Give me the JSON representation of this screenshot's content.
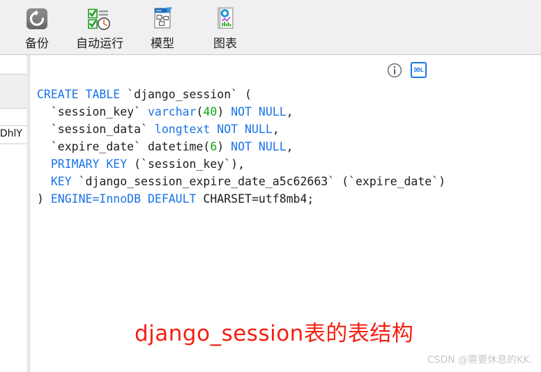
{
  "toolbar": {
    "buttons": [
      {
        "label": "备份",
        "icon": "backup-restore-icon"
      },
      {
        "label": "自动运行",
        "icon": "auto-run-schedule-icon"
      },
      {
        "label": "模型",
        "icon": "model-diagram-icon"
      },
      {
        "label": "图表",
        "icon": "chart-report-icon"
      }
    ]
  },
  "left_panel": {
    "rows": [
      {
        "text": ""
      },
      {
        "text": ""
      },
      {
        "text": "lDhlY"
      },
      {
        "text": ""
      }
    ]
  },
  "content": {
    "actions": [
      {
        "name": "info-icon",
        "label": "i"
      },
      {
        "name": "ddl-icon",
        "label": "DDL"
      }
    ],
    "code_lines": [
      [
        {
          "t": "CREATE TABLE ",
          "c": "kw"
        },
        {
          "t": "`django_session` (",
          "c": "id"
        }
      ],
      [
        {
          "t": "  `session_key` ",
          "c": "id"
        },
        {
          "t": "varchar",
          "c": "kw"
        },
        {
          "t": "(",
          "c": "id"
        },
        {
          "t": "40",
          "c": "num"
        },
        {
          "t": ") ",
          "c": "id"
        },
        {
          "t": "NOT NULL",
          "c": "kw"
        },
        {
          "t": ",",
          "c": "id"
        }
      ],
      [
        {
          "t": "  `session_data` ",
          "c": "id"
        },
        {
          "t": "longtext NOT NULL",
          "c": "kw"
        },
        {
          "t": ",",
          "c": "id"
        }
      ],
      [
        {
          "t": "  `expire_date` datetime",
          "c": "id"
        },
        {
          "t": "(",
          "c": "id"
        },
        {
          "t": "6",
          "c": "num"
        },
        {
          "t": ") ",
          "c": "id"
        },
        {
          "t": "NOT NULL",
          "c": "kw"
        },
        {
          "t": ",",
          "c": "id"
        }
      ],
      [
        {
          "t": "  PRIMARY KEY ",
          "c": "kw"
        },
        {
          "t": "(`session_key`),",
          "c": "id"
        }
      ],
      [
        {
          "t": "  KEY ",
          "c": "kw"
        },
        {
          "t": "`django_session_expire_date_a5c62663` (`expire_date`)",
          "c": "id"
        }
      ],
      [
        {
          "t": ") ",
          "c": "id"
        },
        {
          "t": "ENGINE=InnoDB DEFAULT ",
          "c": "kw"
        },
        {
          "t": "CHARSET=utf8mb4;",
          "c": "id"
        }
      ]
    ],
    "full_sql": "CREATE TABLE `django_session` (\n  `session_key` varchar(40) NOT NULL,\n  `session_data` longtext NOT NULL,\n  `expire_date` datetime(6) NOT NULL,\n  PRIMARY KEY (`session_key`),\n  KEY `django_session_expire_date_a5c62663` (`expire_date`)\n) ENGINE=InnoDB DEFAULT CHARSET=utf8mb4;"
  },
  "annotation": {
    "text": "django_session表的表结构",
    "color": "#f41f12"
  },
  "watermark": {
    "text": "CSDN @需要休息的KK."
  },
  "colors": {
    "keyword": "#1a73e8",
    "number": "#11a61a",
    "identifier": "#1c1c1c",
    "toolbar_bg": "#f0f0f0",
    "accent": "#1a73e8"
  }
}
